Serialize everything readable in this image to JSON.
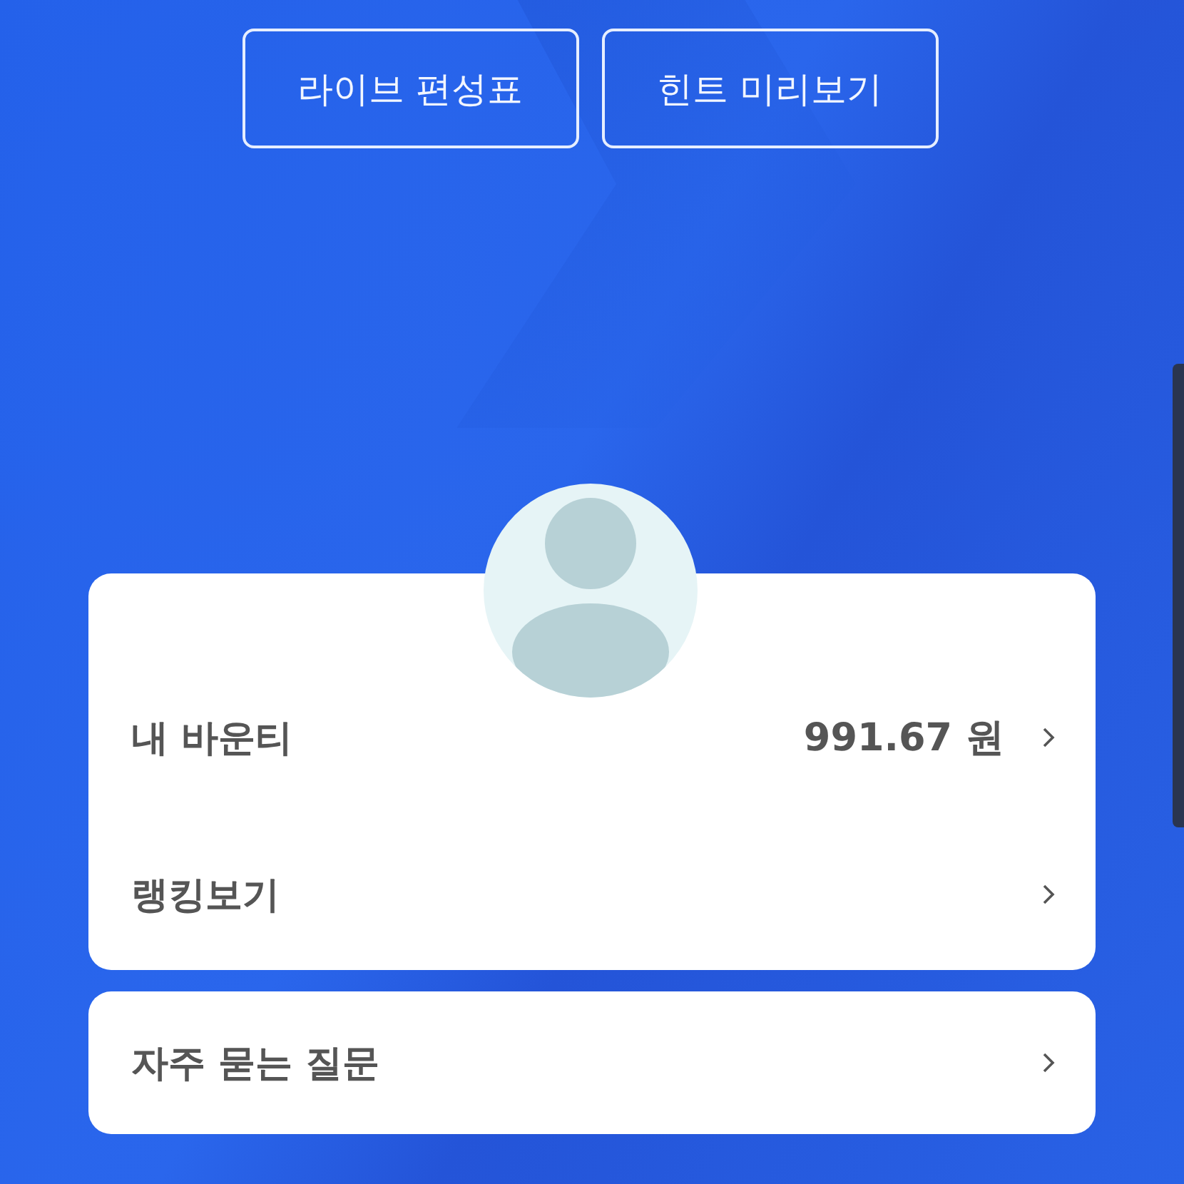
{
  "top_buttons": [
    {
      "label": "라이브 편성표"
    },
    {
      "label": "힌트 미리보기"
    }
  ],
  "profile_card": {
    "rows": [
      {
        "label": "내 바운티",
        "value": "991.67 원"
      },
      {
        "label": "랭킹보기"
      }
    ]
  },
  "faq_card": {
    "rows": [
      {
        "label": "자주 묻는 질문"
      }
    ]
  }
}
